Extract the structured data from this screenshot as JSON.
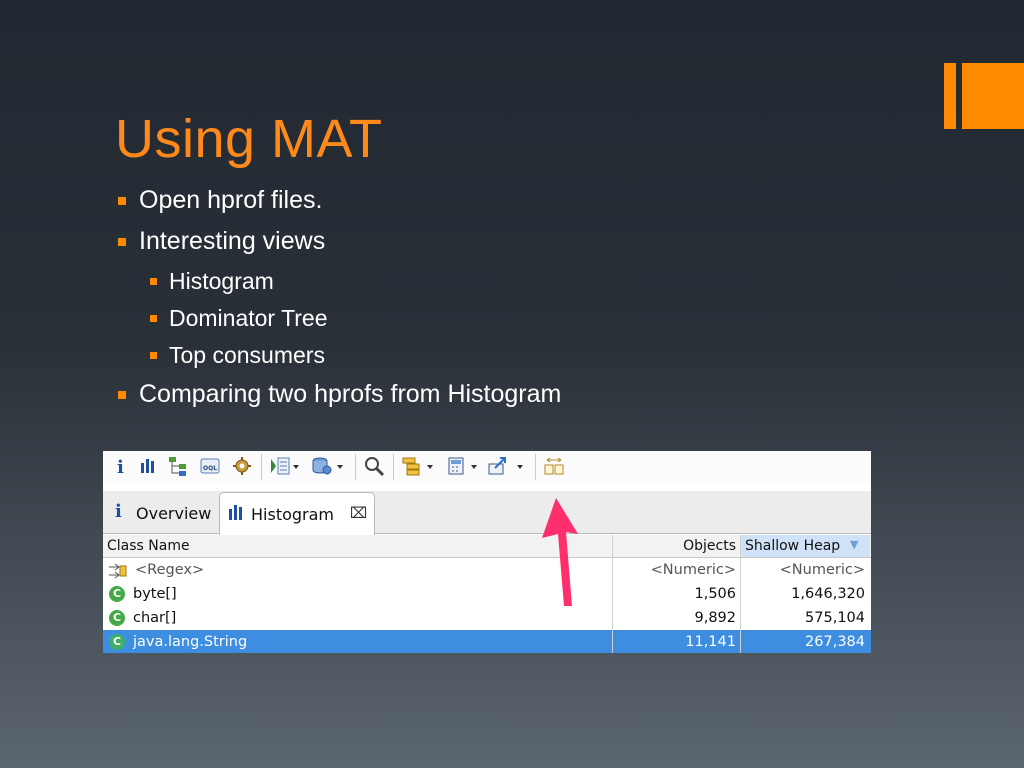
{
  "slide": {
    "title": "Using MAT",
    "accent_color": "#ff8a00",
    "bullets": [
      {
        "level": 1,
        "text": "Open hprof files."
      },
      {
        "level": 1,
        "text": "Interesting views"
      },
      {
        "level": 2,
        "text": "Histogram"
      },
      {
        "level": 2,
        "text": "Dominator Tree"
      },
      {
        "level": 2,
        "text": "Top consumers"
      },
      {
        "level": 1,
        "text": "Comparing two hprofs from Histogram"
      }
    ]
  },
  "mat": {
    "toolbar": {
      "icons": [
        "info-icon",
        "histogram-icon",
        "dominator-tree-icon",
        "oql-icon",
        "settings-icon",
        "query-browser-icon",
        "heap-dump-overview-icon",
        "search-icon",
        "group-by-icon",
        "calculate-retained-icon",
        "export-icon",
        "compare-icon"
      ]
    },
    "tabs": [
      {
        "label": "Overview",
        "icon": "info-icon",
        "active": false
      },
      {
        "label": "Histogram",
        "icon": "histogram-icon",
        "active": true,
        "closable": true
      }
    ],
    "table": {
      "columns": [
        "Class Name",
        "Objects",
        "Shallow Heap"
      ],
      "sorted_column": "Shallow Heap",
      "filter_row": {
        "class_name": "<Regex>",
        "objects": "<Numeric>",
        "shallow_heap": "<Numeric>"
      },
      "rows": [
        {
          "class_name": "byte[]",
          "objects": "1,506",
          "shallow_heap": "1,646,320",
          "selected": false
        },
        {
          "class_name": "char[]",
          "objects": "9,892",
          "shallow_heap": "575,104",
          "selected": false
        },
        {
          "class_name": "java.lang.String",
          "objects": "11,141",
          "shallow_heap": "267,384",
          "selected": true
        }
      ],
      "selection_color": "#3d8ee0",
      "class_icon_color": "#44a845"
    },
    "annotation": {
      "type": "arrow",
      "color": "#ff2f6e",
      "points_to": "compare-icon"
    }
  }
}
